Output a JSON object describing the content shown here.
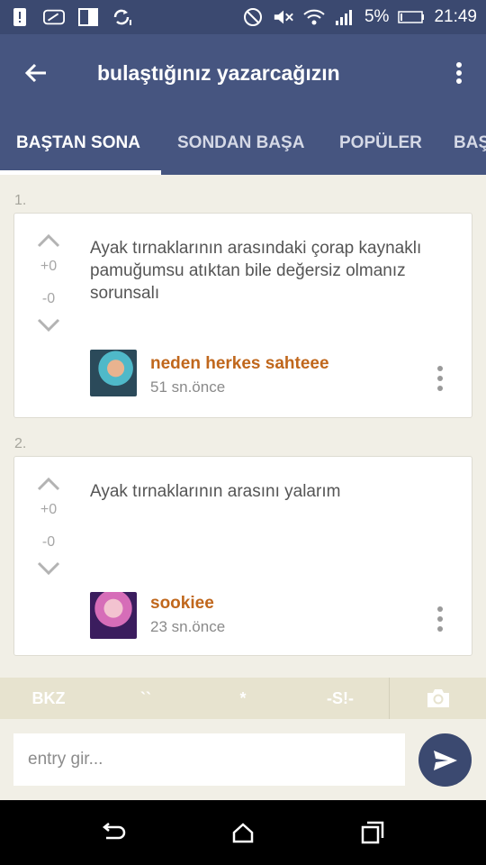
{
  "status_bar": {
    "battery": "5%",
    "time": "21:49",
    "icons_left": [
      "alert-icon",
      "cast-icon",
      "screen-icon",
      "sync-icon"
    ],
    "icons_right": [
      "do-not-disturb-icon",
      "mute-icon",
      "wifi-icon",
      "signal-icon",
      "battery-icon"
    ]
  },
  "app_bar": {
    "title": "bulaştığınız yazarcağızın"
  },
  "tabs": [
    {
      "label": "BAŞTAN SONA",
      "active": true
    },
    {
      "label": "SONDAN BAŞA",
      "active": false
    },
    {
      "label": "POPÜLER",
      "active": false
    },
    {
      "label": "BAŞ",
      "active": false
    }
  ],
  "entries": [
    {
      "number": "1.",
      "text": "Ayak tırnaklarının arasındaki çorap kaynaklı pamuğumsu atıktan bile değersiz olmanız sorunsalı",
      "upvotes": "+0",
      "downvotes": "-0",
      "author": "neden herkes sahteee",
      "time": "51 sn.önce"
    },
    {
      "number": "2.",
      "text": "Ayak tırnaklarının arasını yalarım",
      "upvotes": "+0",
      "downvotes": "-0",
      "author": "sookiee",
      "time": "23 sn.önce"
    }
  ],
  "toolbar": {
    "bkz": "BKZ",
    "quote": "``",
    "star": "*",
    "spoiler": "-S!-"
  },
  "composer": {
    "placeholder": "entry gir..."
  },
  "colors": {
    "primary": "#465580",
    "status_bar": "#3b4970",
    "author": "#c0671c",
    "background": "#f1efe6"
  }
}
